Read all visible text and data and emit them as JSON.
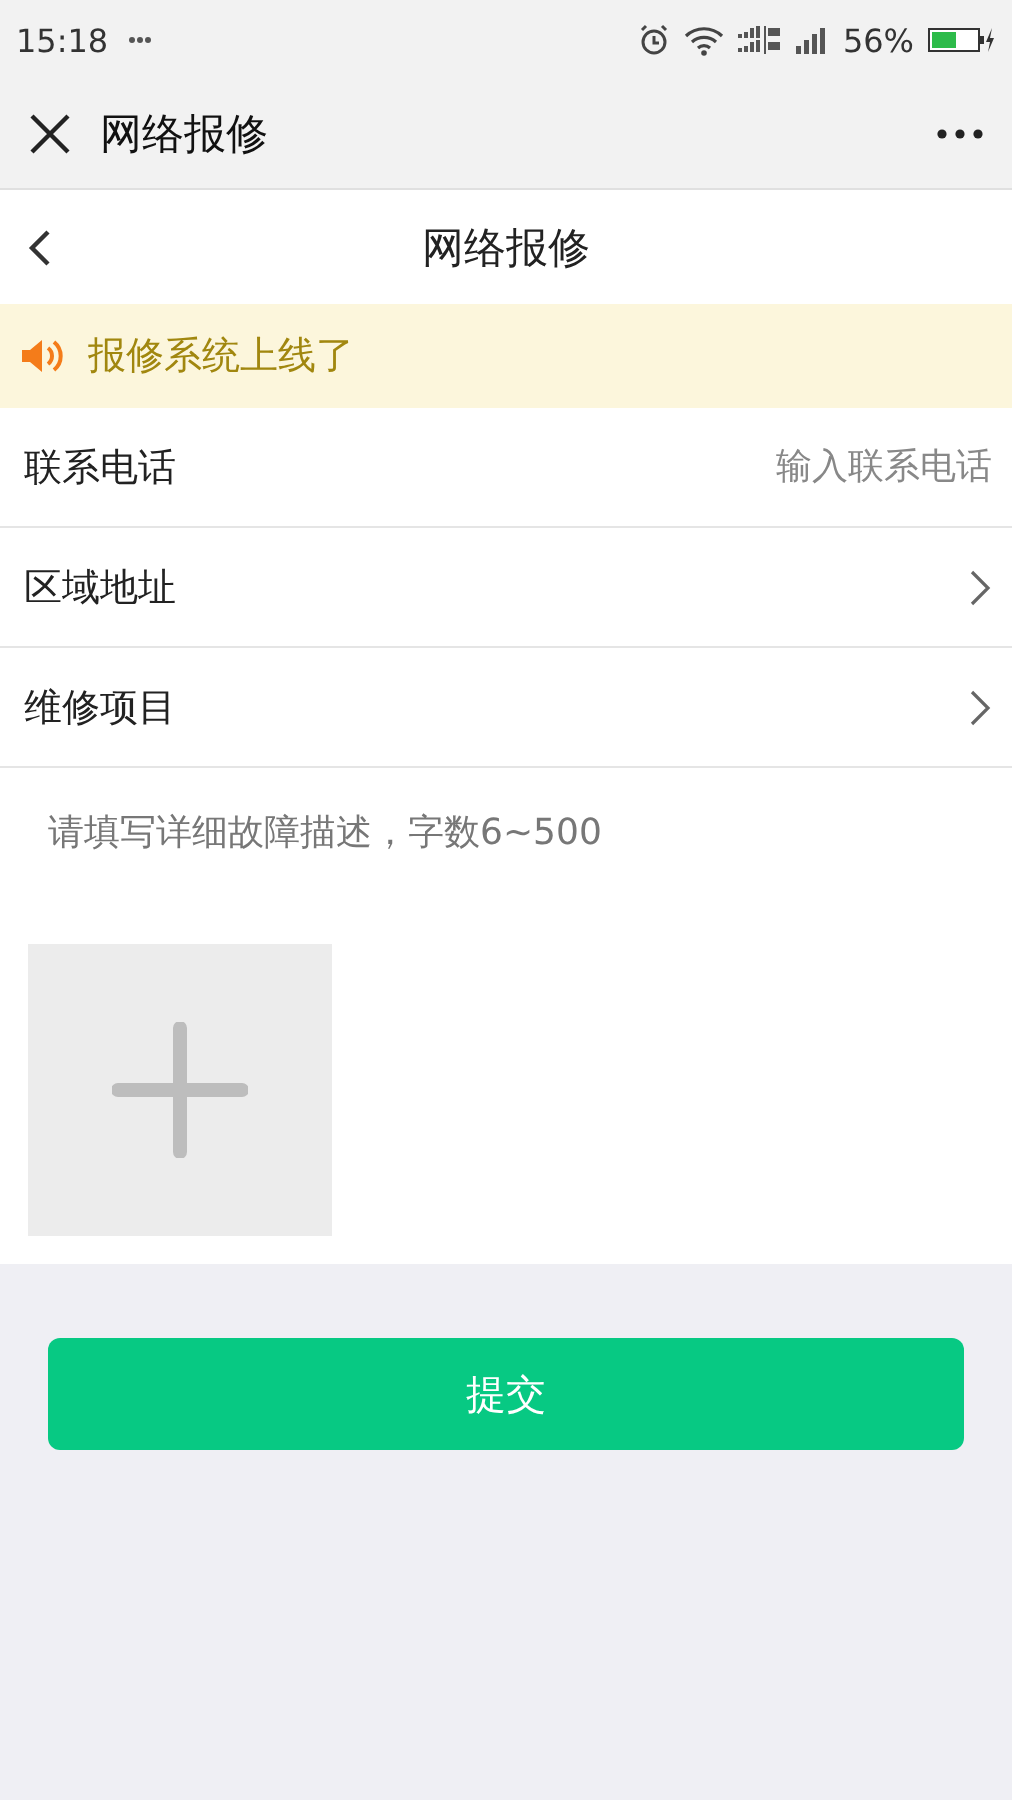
{
  "status_bar": {
    "time": "15:18",
    "battery": "56%"
  },
  "header": {
    "title": "网络报修"
  },
  "page": {
    "title": "网络报修"
  },
  "notice": {
    "text": "报修系统上线了"
  },
  "form": {
    "fields": [
      {
        "kind": "input",
        "label": "联系电话",
        "placeholder": "输入联系电话"
      },
      {
        "kind": "select",
        "label": "区域地址"
      },
      {
        "kind": "select",
        "label": "维修项目"
      }
    ],
    "description": {
      "placeholder": "请填写详细故障描述，字数6~500"
    }
  },
  "submit": {
    "label": "提交"
  }
}
